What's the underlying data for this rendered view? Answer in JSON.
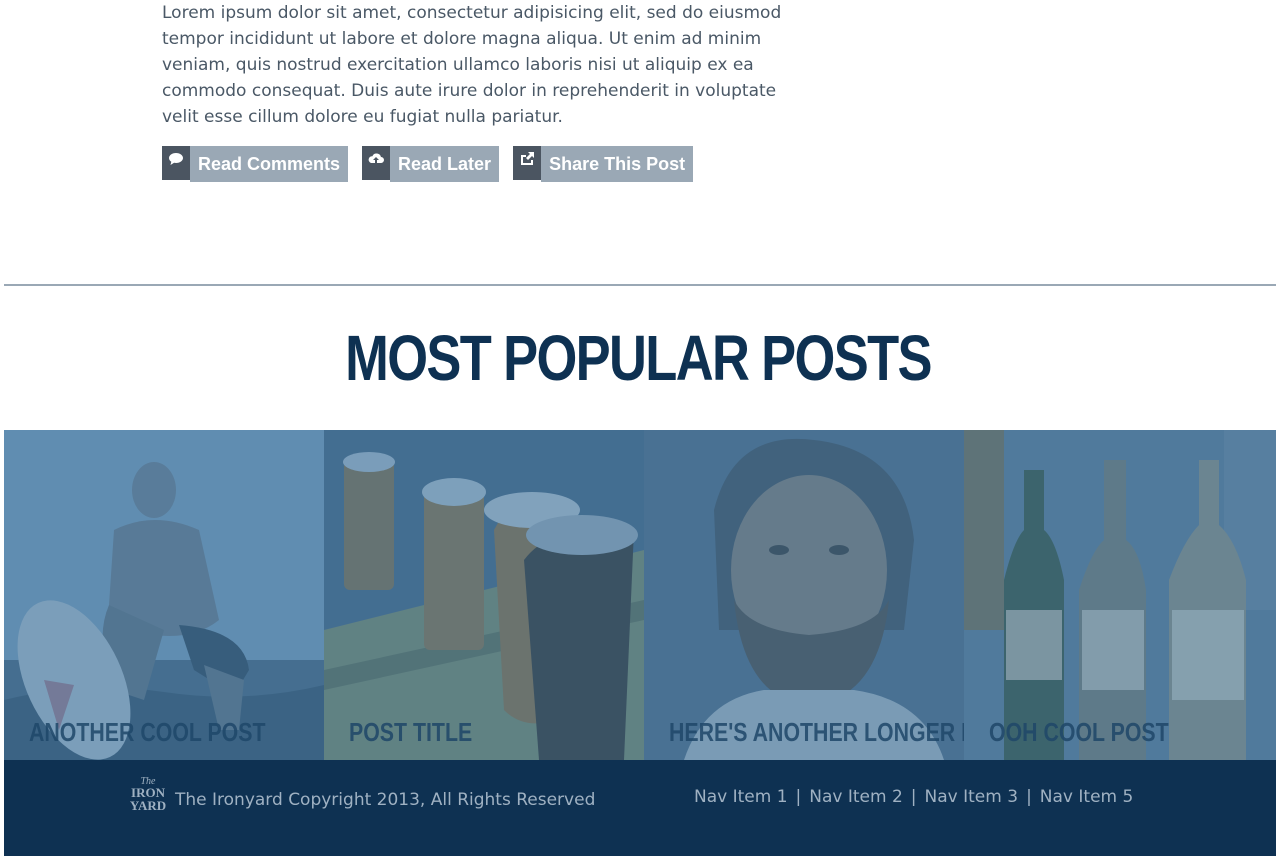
{
  "post": {
    "excerpt": "Lorem ipsum dolor sit amet, consectetur adipisicing elit, sed do eiusmod tempor incididunt ut labore et dolore magna aliqua. Ut enim ad minim veniam, quis nostrud exercitation ullamco laboris nisi ut aliquip ex ea commodo consequat. Duis aute irure dolor in reprehenderit in voluptate velit esse cillum dolore eu fugiat nulla pariatur.",
    "actions": [
      {
        "label": "Read Comments",
        "icon": "speech-bubble-icon"
      },
      {
        "label": "Read Later",
        "icon": "cloud-upload-icon"
      },
      {
        "label": "Share This Post",
        "icon": "share-icon"
      }
    ]
  },
  "popular": {
    "title": "MOST POPULAR POSTS",
    "posts": [
      {
        "caption": "ANOTHER COOL POST",
        "image": "surfer-photo"
      },
      {
        "caption": "POST TITLE",
        "image": "beer-glasses-photo"
      },
      {
        "caption": "HERE'S ANOTHER LONGER POST",
        "image": "bearded-man-photo"
      },
      {
        "caption": "OOH COOL POST",
        "image": "liquor-bottles-photo"
      }
    ]
  },
  "footer": {
    "logo_text": [
      "The",
      "IRON",
      "YARD"
    ],
    "copyright": "The Ironyard Copyright 2013, All Rights Reserved",
    "nav": [
      "Nav Item 1",
      "Nav Item 2",
      "Nav Item 3",
      "Nav Item 5"
    ],
    "separator": "|"
  },
  "colors": {
    "navy": "#0e3152",
    "button_label_bg": "#9aa8b5",
    "button_icon_bg": "#4b5561",
    "overlay": "#3a6e96"
  }
}
